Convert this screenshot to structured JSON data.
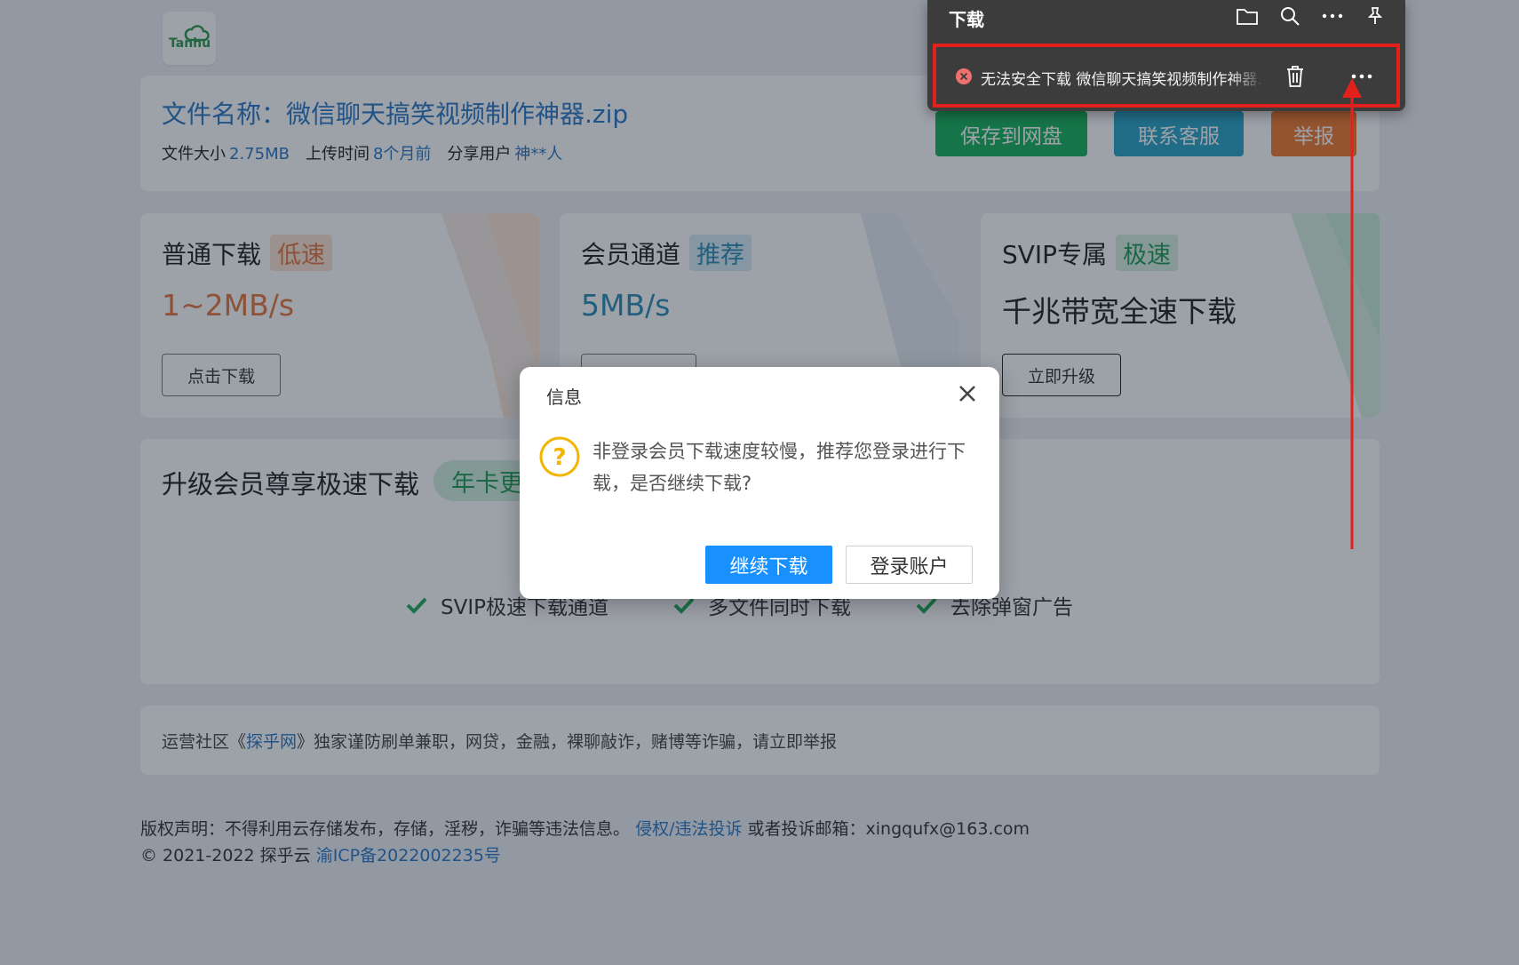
{
  "logo": {
    "text": "Tanhu"
  },
  "file": {
    "title": "文件名称：微信聊天搞笑视频制作神器.zip",
    "size_label": "文件大小",
    "size_value": "2.75MB",
    "upload_label": "上传时间",
    "upload_value": "8个月前",
    "user_label": "分享用户",
    "user_value": "神**人"
  },
  "actions": {
    "save": "保存到网盘",
    "service": "联系客服",
    "report": "举报"
  },
  "tiers": [
    {
      "title": "普通下载",
      "tag": "低速",
      "speed": "1~2MB/s",
      "button": "点击下载"
    },
    {
      "title": "会员通道",
      "tag": "推荐",
      "speed": "5MB/s",
      "button": ""
    },
    {
      "title": "SVIP专属",
      "tag": "极速",
      "speed": "千兆带宽全速下载",
      "button": "立即升级"
    }
  ],
  "upgrade": {
    "title": "升级会员尊享极速下载",
    "tag": "年卡更",
    "features": [
      "SVIP极速下载通道",
      "多文件同时下载",
      "去除弹窗广告"
    ]
  },
  "notice": {
    "prefix": "运营社区《",
    "link": "探乎网",
    "suffix": "》独家谨防刷单兼职，网贷，金融，裸聊敲诈，赌博等诈骗，请立即举报"
  },
  "footer": {
    "copyright_text": "版权声明：不得利用云存储发布，存储，淫秽，诈骗等违法信息。",
    "complaint_link": "侵权/违法投诉",
    "email_text": "或者投诉邮箱：xingqufx@163.com",
    "year_text": "© 2021-2022 探乎云",
    "icp_link": "渝ICP备2022002235号"
  },
  "modal": {
    "title": "信息",
    "message": "非登录会员下载速度较慢，推荐您登录进行下载，是否继续下载?",
    "continue": "继续下载",
    "login": "登录账户"
  },
  "download_panel": {
    "title": "下载",
    "item_text": "无法安全下载 微信聊天搞笑视频制作神器.zip"
  },
  "colors": {
    "link": "#2a79c6",
    "save": "#17b35b",
    "service": "#2aa6c8",
    "report": "#f07a30",
    "primary": "#1890ff",
    "highlight": "#e3201b"
  }
}
